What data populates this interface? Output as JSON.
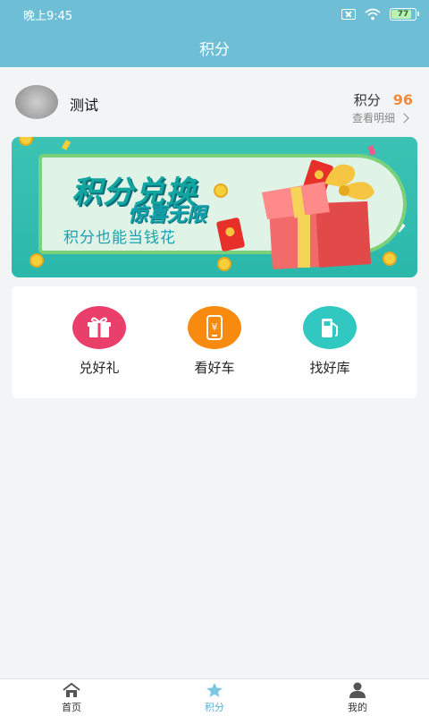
{
  "status_bar": {
    "time": "晚上9:45",
    "battery": "77"
  },
  "header": {
    "title": "积分"
  },
  "profile": {
    "username": "测试",
    "points_label": "积分",
    "points_value": "96",
    "detail_link": "查看明细"
  },
  "banner": {
    "title": "积分兑换",
    "subtitle": "惊喜无限",
    "slogan": "积分也能当钱花"
  },
  "features": [
    {
      "label": "兑好礼",
      "icon": "gift-icon",
      "color": "#ea3f6b"
    },
    {
      "label": "看好车",
      "icon": "phone-yen-icon",
      "color": "#f98a10"
    },
    {
      "label": "找好库",
      "icon": "gas-station-icon",
      "color": "#30c8c0"
    }
  ],
  "tabs": [
    {
      "label": "首页",
      "icon": "home-icon"
    },
    {
      "label": "积分",
      "icon": "star-icon",
      "active": true
    },
    {
      "label": "我的",
      "icon": "user-icon"
    }
  ],
  "colors": {
    "header_bg": "#6ebfd6",
    "points_accent": "#f08a3c",
    "active_tab": "#5ab0d6"
  }
}
